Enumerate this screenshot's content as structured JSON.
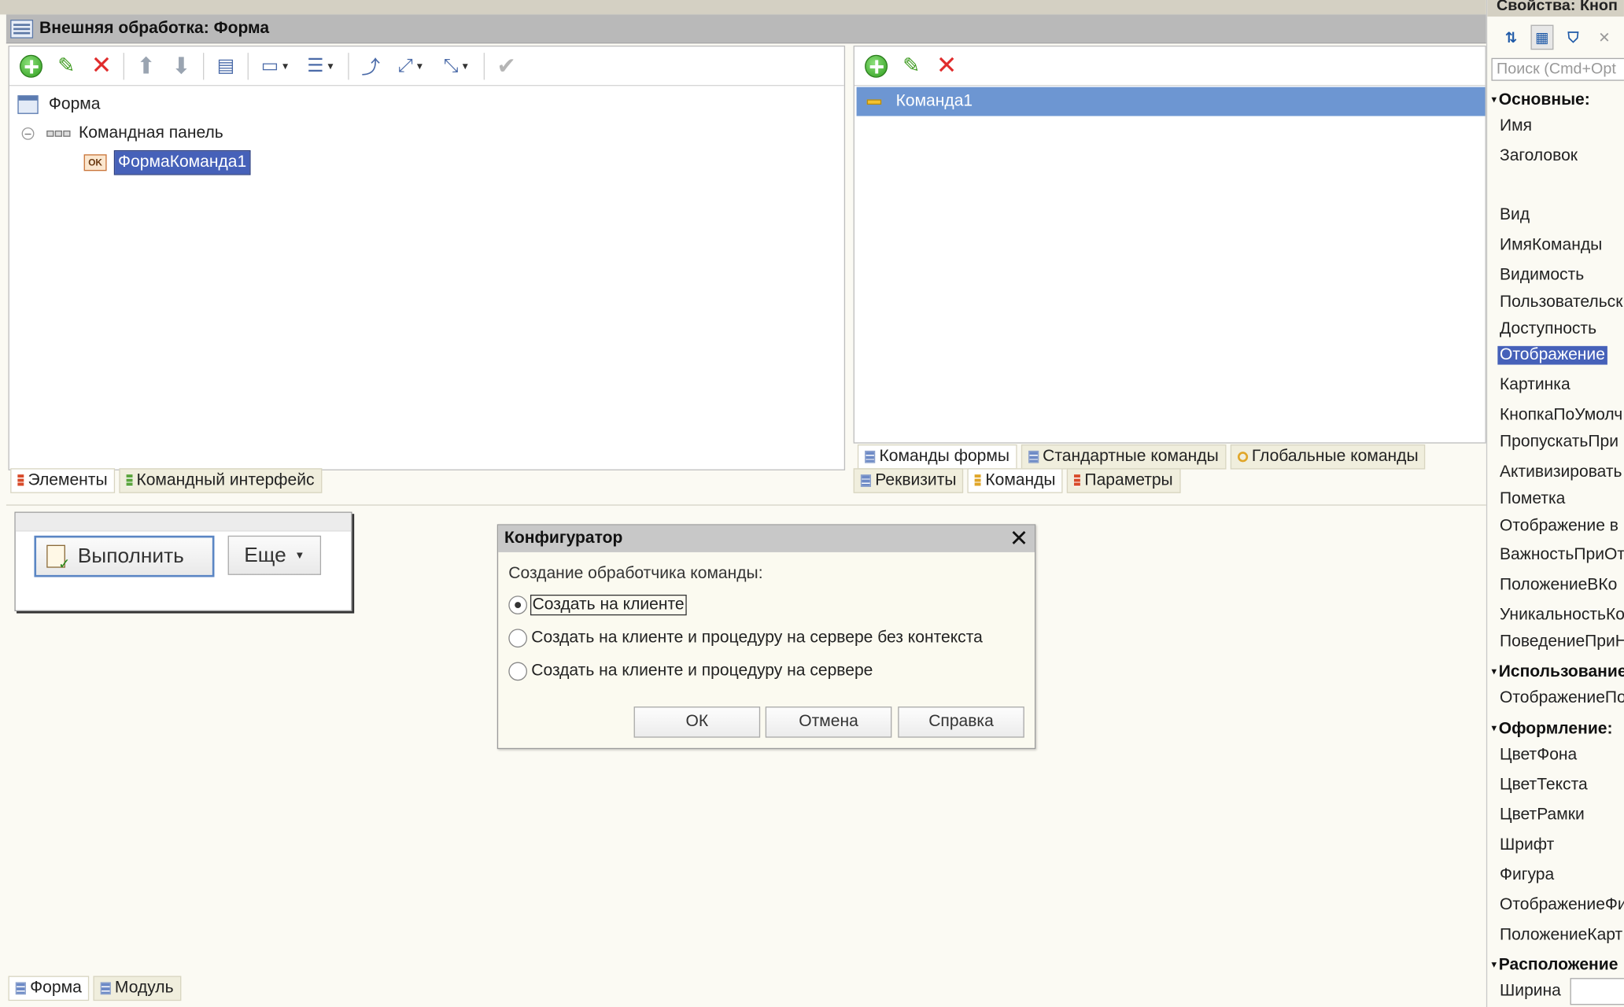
{
  "window": {
    "title": "Внешняя обработка: Форма"
  },
  "left_panel": {
    "tree": [
      {
        "label": "Форма"
      },
      {
        "label": "Командная панель"
      },
      {
        "label": "ФормаКоманда1"
      }
    ],
    "tabs": [
      {
        "label": "Элементы"
      },
      {
        "label": "Командный интерфейс"
      }
    ]
  },
  "right_panel": {
    "selected_command": "Команда1",
    "tabs_top": [
      {
        "label": "Команды формы"
      },
      {
        "label": "Стандартные команды"
      },
      {
        "label": "Глобальные команды"
      }
    ],
    "tabs_bottom": [
      {
        "label": "Реквизиты"
      },
      {
        "label": "Команды"
      },
      {
        "label": "Параметры"
      }
    ]
  },
  "preview": {
    "execute_label": "Выполнить",
    "more_label": "Еще"
  },
  "dialog": {
    "title": "Конфигуратор",
    "prompt": "Создание обработчика команды:",
    "options": [
      {
        "label": "Создать на клиенте",
        "selected": true
      },
      {
        "label": "Создать на клиенте и процедуру на сервере без контекста",
        "selected": false
      },
      {
        "label": "Создать на клиенте и процедуру на сервере",
        "selected": false
      }
    ],
    "buttons": {
      "ok": "ОК",
      "cancel": "Отмена",
      "help": "Справка"
    }
  },
  "bottom_tabs": [
    {
      "label": "Форма"
    },
    {
      "label": "Модуль"
    }
  ],
  "properties": {
    "header": "Свойства: Кноп",
    "search_placeholder": "Поиск (Cmd+Opt",
    "groups": {
      "main": "Основные:",
      "usage": "Использование",
      "appearance": "Оформление:",
      "layout": "Расположение"
    },
    "items": {
      "name": "Имя",
      "title": "Заголовок",
      "kind": "Вид",
      "command_name": "ИмяКоманды",
      "visibility": "Видимость",
      "user": "Пользовательск",
      "availability": "Доступность",
      "display": "Отображение",
      "picture": "Картинка",
      "default_button": "КнопкаПоУмолч",
      "skip": "ПропускатьПри",
      "activate": "Активизировать",
      "mark": "Пометка",
      "display_in": "Отображение в",
      "importance": "ВажностьПриОт",
      "position": "ПоложениеВКо",
      "uniqueness": "УникальностьКо",
      "behavior": "ПоведениеПриН",
      "display_usage": "ОтображениеПо",
      "bg_color": "ЦветФона",
      "text_color": "ЦветТекста",
      "border_color": "ЦветРамки",
      "font": "Шрифт",
      "shape": "Фигура",
      "shape_display": "ОтображениеФи",
      "picture_position": "ПоложениеКарт",
      "width": "Ширина"
    }
  },
  "colors": {
    "selection": "#4661b9",
    "list_selection": "#6d96d2",
    "panel_bg": "#fbfaf3"
  }
}
